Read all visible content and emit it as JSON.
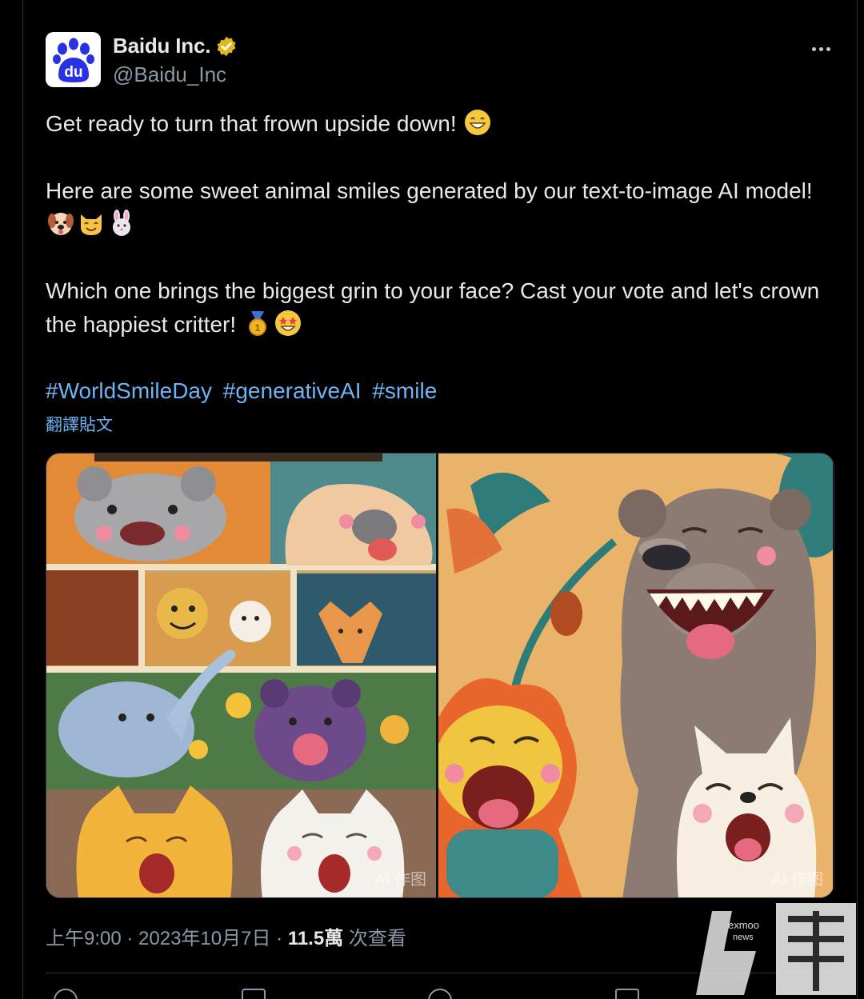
{
  "author": {
    "name": "Baidu Inc.",
    "handle": "@Baidu_Inc",
    "avatar_text": "du",
    "verified": true,
    "verified_color": "#e2b719"
  },
  "tweet": {
    "line1": "Get ready to turn that frown upside down!",
    "line2": "Here are some sweet animal smiles generated by our text-to-image AI model!",
    "line3": "Which one brings the biggest grin to your face? Cast your vote and let's crown the happiest critter!",
    "hashtags": [
      "#WorldSmileDay",
      "#generativeAI",
      "#smile"
    ],
    "translate_label": "翻譯貼文"
  },
  "media": {
    "left_watermark": "AI 作图",
    "right_watermark": "AI 作图"
  },
  "meta": {
    "time": "上午9:00",
    "sep1": " · ",
    "date": "2023年10月7日",
    "sep2": " · ",
    "views": "11.5萬",
    "views_label": " 次查看"
  },
  "overlay": {
    "brand_small_top": "exmoo",
    "brand_small_bottom": "news"
  },
  "icons": {
    "more": "more-icon",
    "verified": "verified-badge-icon"
  }
}
